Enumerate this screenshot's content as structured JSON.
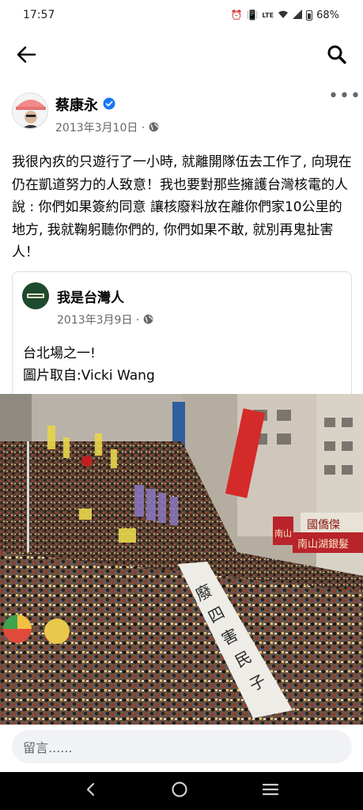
{
  "status_bar": {
    "time": "17:57",
    "battery": "68%",
    "icons": [
      "alarm-icon",
      "vibrate-icon",
      "volte-icon",
      "wifi-icon",
      "signal-icon",
      "battery-icon"
    ]
  },
  "top_bar": {
    "back_icon": "arrow-left-icon",
    "search_icon": "search-icon"
  },
  "post": {
    "author": "蔡康永",
    "date": "2013年3月10日",
    "date_separator": "·",
    "text": "我很內疚的只遊行了一小時, 就離開隊伍去工作了, 向現在仍在凱道努力的人致意！我也要對那些擁護台灣核電的人說 : 你們如果簽約同意 讓核廢料放在離你們家10公里的地方, 我就鞠躬聽你們的, 你們如果不敢, 就別再鬼扯害人！",
    "more_label": "•••"
  },
  "shared": {
    "page_name": "我是台灣人",
    "date": "2013年3月9日",
    "date_separator": "·",
    "line1": "台北場之一!",
    "line2": "圖片取自:Vicki Wang"
  },
  "photo": {
    "banner_text": "廢四害民殃及子孫",
    "sign_rightmost": "國僑傑",
    "sign_shop": "南山湖銀髮",
    "sign_shop_short": "南山"
  },
  "comment": {
    "placeholder": "留言......"
  },
  "colors": {
    "accent": "#1877f2",
    "secondary_text": "#65676b"
  }
}
